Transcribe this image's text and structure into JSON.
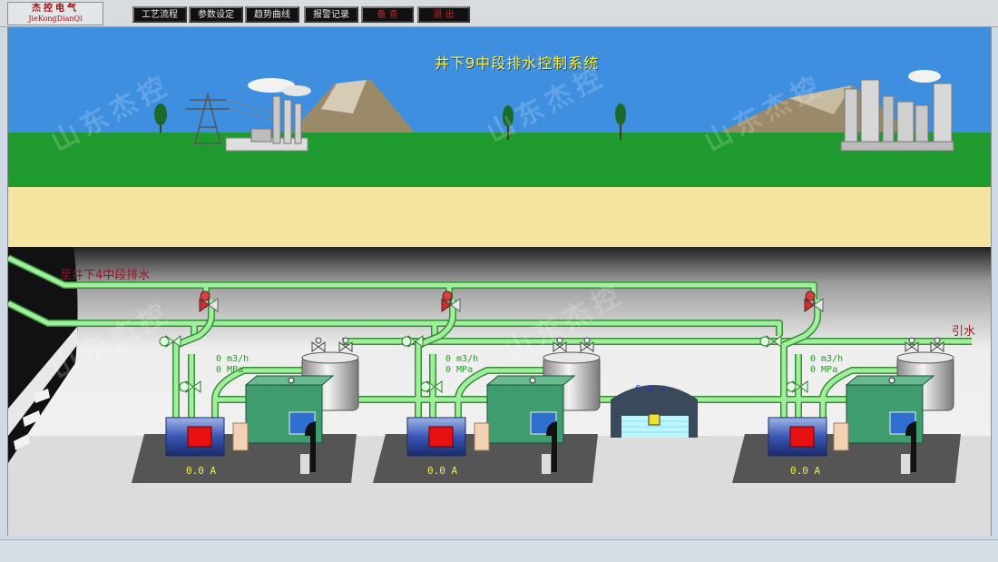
{
  "header": {
    "logo_cn": "杰控电气",
    "logo_pinyin": "JieKongDianQi"
  },
  "nav": [
    {
      "label": "工艺流程"
    },
    {
      "label": "参数设定"
    },
    {
      "label": "趋势曲线"
    },
    {
      "label": "报警记录"
    },
    {
      "label": "备 查"
    },
    {
      "label": "退 出"
    }
  ],
  "scada": {
    "title": "井下9中段排水控制系统",
    "inlet_label": "至井下4中段排水",
    "priming_label": "引水",
    "sump_level": "6.8 m",
    "watermark": "山东杰控",
    "pumps": [
      {
        "flow": "0 m3/h",
        "pressure": "0 MPa",
        "current": "0.0 A"
      },
      {
        "flow": "0 m3/h",
        "pressure": "0 MPa",
        "current": "0.0 A"
      },
      {
        "flow": "0 m3/h",
        "pressure": "0 MPa",
        "current": "0.0 A"
      }
    ]
  },
  "colors": {
    "sky": "#3f8fe0",
    "grass": "#1f9a2e",
    "sand": "#f4e4a0",
    "pipe": "#9ff09a",
    "motor_red": "#e81010",
    "pump_green": "#3e9c6e",
    "nav_bg": "#111111"
  },
  "icons": [
    "valve-icon",
    "pump-motor-icon",
    "water-tank-icon",
    "power-tower-icon",
    "factory-icon",
    "tree-icon"
  ]
}
